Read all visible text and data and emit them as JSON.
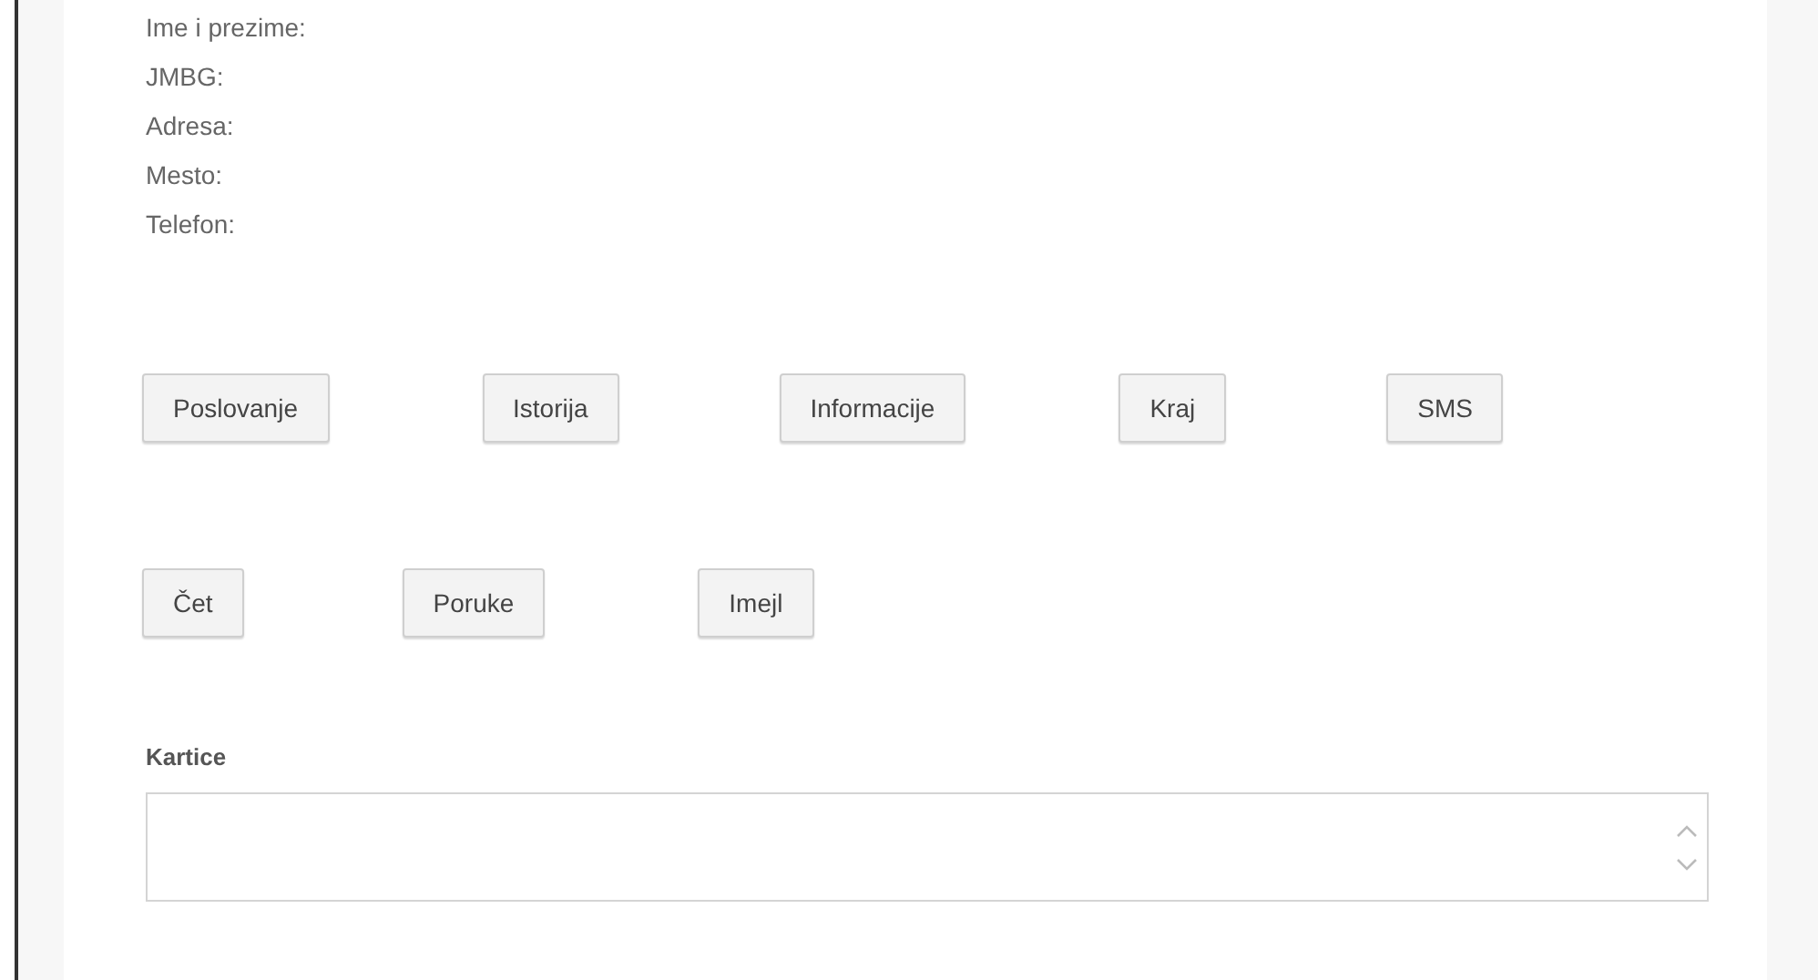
{
  "fields": [
    {
      "label": "Ime i prezime:"
    },
    {
      "label": "JMBG:"
    },
    {
      "label": "Adresa:"
    },
    {
      "label": "Mesto:"
    },
    {
      "label": "Telefon:"
    }
  ],
  "button_rows": [
    [
      "Poslovanje",
      "Istorija",
      "Informacije",
      "Kraj",
      "SMS"
    ],
    [
      "Čet",
      "Poruke",
      "Imejl"
    ]
  ],
  "cards": {
    "label": "Kartice"
  }
}
